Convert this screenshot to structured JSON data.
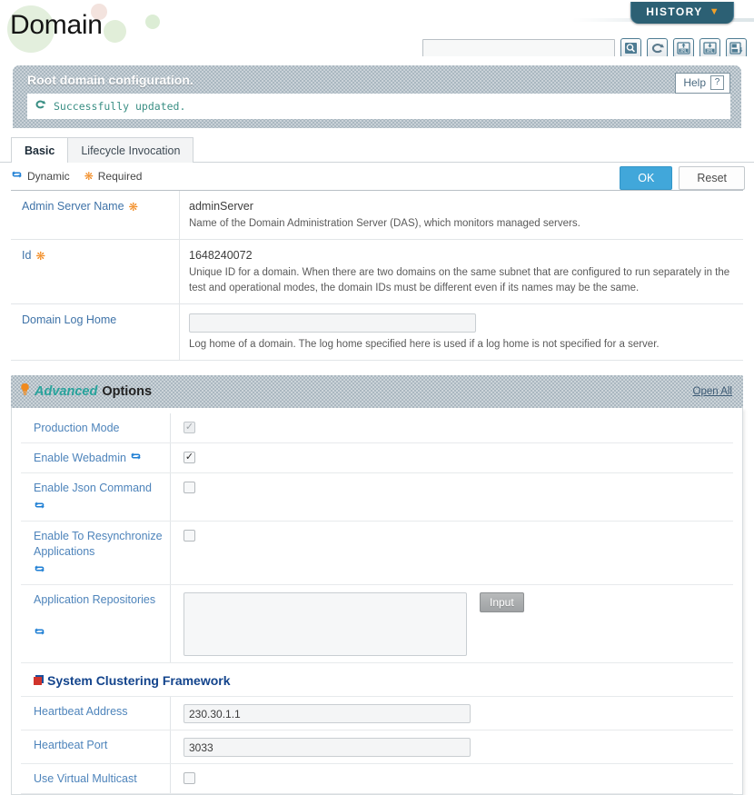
{
  "header": {
    "title": "Domain",
    "history_button": "HISTORY",
    "history_chevron_icon": "chevron-down-icon",
    "search": {
      "value": "",
      "placeholder": ""
    },
    "toolbar_icons": [
      {
        "name": "search-icon",
        "label": "Search"
      },
      {
        "name": "reload-icon",
        "label": "Reload"
      },
      {
        "name": "xml-upload-icon",
        "label": "XML Upload"
      },
      {
        "name": "xml-download-icon",
        "label": "XML Download"
      },
      {
        "name": "export-icon",
        "label": "Export"
      }
    ]
  },
  "message_panel": {
    "title": "Root domain configuration.",
    "status_icon": "refresh-icon",
    "status_text": "Successfully updated.",
    "help_label": "Help",
    "help_icon": "question-icon"
  },
  "tabs": [
    {
      "label": "Basic",
      "active": true
    },
    {
      "label": "Lifecycle Invocation",
      "active": false
    }
  ],
  "legend": {
    "dynamic_icon": "dynamic-refresh-icon",
    "dynamic_label": "Dynamic",
    "required_icon": "required-asterisk-icon",
    "required_label": "Required"
  },
  "actions": {
    "ok_label": "OK",
    "reset_label": "Reset"
  },
  "basic_rows": [
    {
      "label": "Admin Server Name",
      "required": true,
      "dynamic": false,
      "value": "adminServer",
      "input": false,
      "description": "Name of the Domain Administration Server (DAS), which monitors managed servers."
    },
    {
      "label": "Id",
      "required": true,
      "dynamic": false,
      "value": "1648240072",
      "input": false,
      "description": "Unique ID for a domain. When there are two domains on the same subnet that are configured to run separately in the test and operational modes, the domain IDs must be different even if its names may be the same."
    },
    {
      "label": "Domain Log Home",
      "required": false,
      "dynamic": false,
      "value": "",
      "input": true,
      "description": "Log home of a domain. The log home specified here is used if a log home is not specified for a server."
    }
  ],
  "advanced": {
    "bulb_icon": "lightbulb-icon",
    "title_emphasis": "Advanced",
    "title_rest": "Options",
    "open_all_label": "Open All",
    "rows": [
      {
        "label": "Production Mode",
        "dynamic": false,
        "type": "checkbox",
        "checked": true,
        "disabled": true
      },
      {
        "label": "Enable Webadmin",
        "dynamic": true,
        "type": "checkbox",
        "checked": true,
        "disabled": false
      },
      {
        "label": "Enable Json Command",
        "dynamic": true,
        "type": "checkbox",
        "checked": false,
        "disabled": false
      },
      {
        "label": "Enable To Resynchronize Applications",
        "dynamic": true,
        "type": "checkbox",
        "checked": false,
        "disabled": false
      },
      {
        "label": "Application Repositories",
        "dynamic": true,
        "type": "textarea",
        "value": "",
        "button_label": "Input"
      }
    ],
    "section": {
      "icon": "cluster-icon",
      "title": "System Clustering Framework",
      "rows": [
        {
          "label": "Heartbeat Address",
          "type": "text",
          "value": "230.30.1.1"
        },
        {
          "label": "Heartbeat Port",
          "type": "text",
          "value": "3033"
        },
        {
          "label": "Use Virtual Multicast",
          "type": "checkbox",
          "checked": false,
          "disabled": false
        }
      ]
    }
  }
}
